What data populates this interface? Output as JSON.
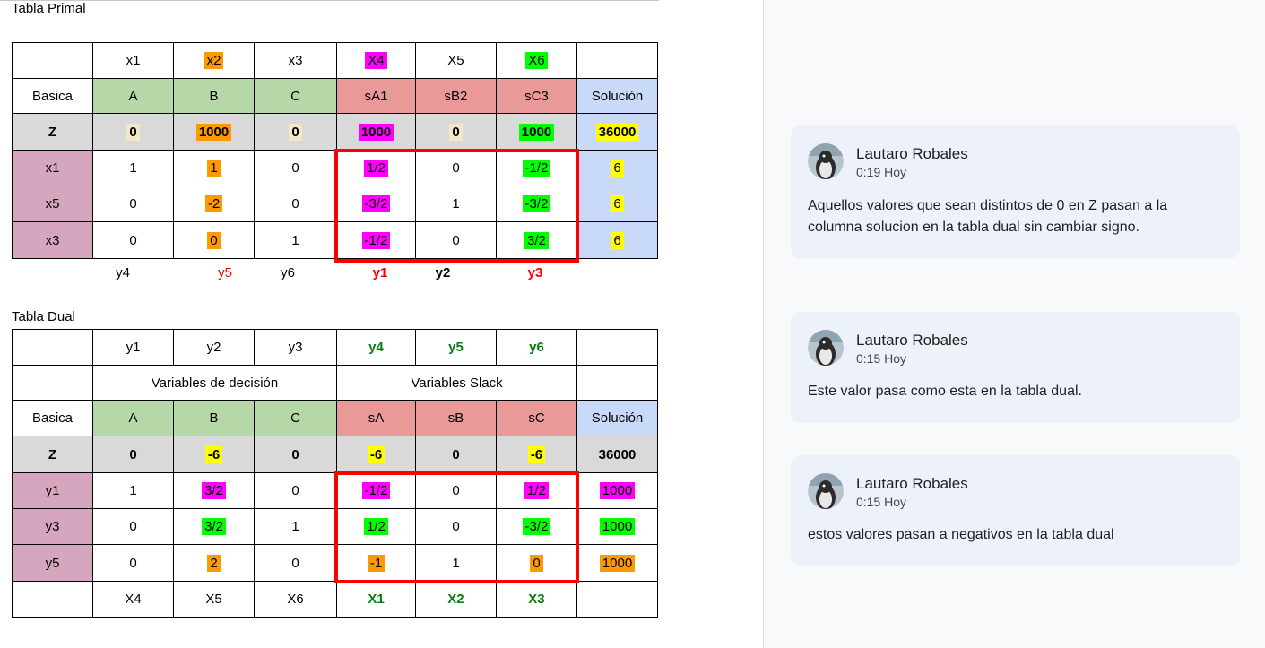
{
  "primal": {
    "title": "Tabla Primal",
    "header": [
      "",
      "x1",
      "x2",
      "x3",
      "X4",
      "X5",
      "X6",
      ""
    ],
    "labels": [
      "Basica",
      "A",
      "B",
      "C",
      "sA1",
      "sB2",
      "sC3",
      "Solución"
    ],
    "z": [
      "Z",
      "0",
      "1000",
      "0",
      "1000",
      "0",
      "1000",
      "36000"
    ],
    "rows": [
      [
        "x1",
        "1",
        "1",
        "0",
        "1/2",
        "0",
        "-1/2",
        "6"
      ],
      [
        "x5",
        "0",
        "-2",
        "0",
        "-3/2",
        "1",
        "-3/2",
        "6"
      ],
      [
        "x3",
        "0",
        "0",
        "1",
        "-1/2",
        "0",
        "3/2",
        "6"
      ]
    ],
    "under": [
      "y4",
      "y5",
      "y6",
      "y1",
      "y2",
      "y3"
    ]
  },
  "dual": {
    "title": "Tabla Dual",
    "header": [
      "",
      "y1",
      "y2",
      "y3",
      "y4",
      "y5",
      "y6",
      ""
    ],
    "groups": {
      "decision": "Variables de decisión",
      "slack": "Variables Slack"
    },
    "labels": [
      "Basica",
      "A",
      "B",
      "C",
      "sA",
      "sB",
      "sC",
      "Solución"
    ],
    "z": [
      "Z",
      "0",
      "-6",
      "0",
      "-6",
      "0",
      "-6",
      "36000"
    ],
    "rows": [
      [
        "y1",
        "1",
        "3/2",
        "0",
        "-1/2",
        "0",
        "1/2",
        "1000"
      ],
      [
        "y3",
        "0",
        "3/2",
        "1",
        "1/2",
        "0",
        "-3/2",
        "1000"
      ],
      [
        "y5",
        "0",
        "2",
        "0",
        "-1",
        "1",
        "0",
        "1000"
      ]
    ],
    "footer": [
      "",
      "X4",
      "X5",
      "X6",
      "X1",
      "X2",
      "X3",
      ""
    ]
  },
  "comments": [
    {
      "author": "Lautaro Robales",
      "time": "0:19 Hoy",
      "text": "Aquellos valores que sean distintos de 0 en Z pasan a la columna solucion en la tabla dual sin cambiar signo."
    },
    {
      "author": "Lautaro Robales",
      "time": "0:15 Hoy",
      "text": "Este valor pasa como esta en la tabla dual."
    },
    {
      "author": "Lautaro Robales",
      "time": "0:15 Hoy",
      "text": "estos valores pasan a negativos en la tabla dual"
    }
  ],
  "colors": {
    "decision_header": "#b6d7a8",
    "slack_header": "#ea9999",
    "solution_header": "#c9daf8",
    "z_row": "#d9d9d9",
    "basic_var": "#d5a6bd",
    "highlight_magenta": "#ff00ff",
    "highlight_orange": "#ff9900",
    "highlight_green": "#00ff00",
    "highlight_yellow": "#ffff00",
    "box_red": "#ff0000",
    "card_bg": "#edf2fa"
  },
  "icons": {
    "avatar": "penguin-avatar-icon"
  }
}
